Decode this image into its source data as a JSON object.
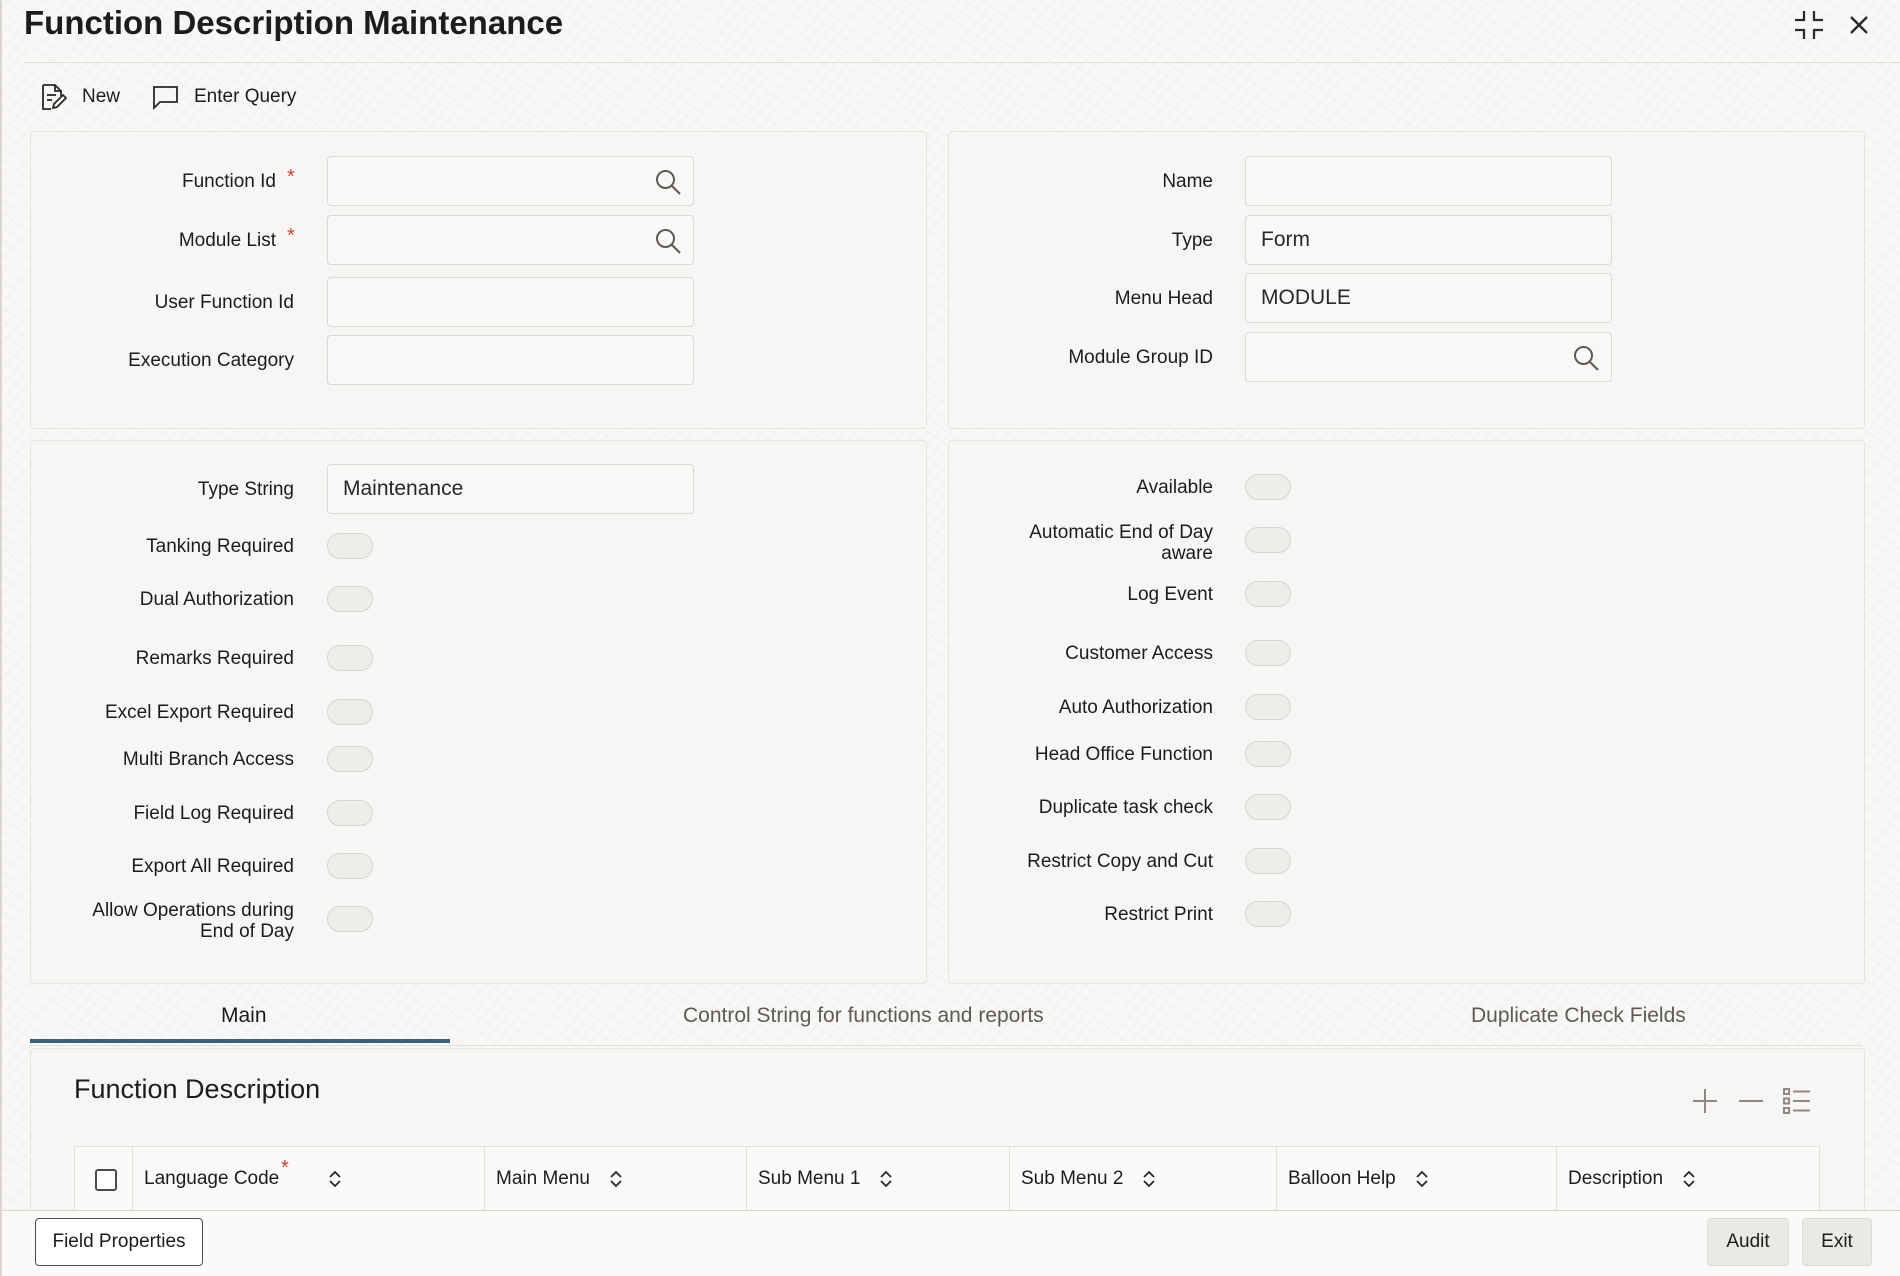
{
  "window": {
    "title": "Function Description Maintenance",
    "restore_label": "restore-window",
    "close_label": "close-window"
  },
  "toolbar": {
    "new_label": "New",
    "enter_query_label": "Enter Query"
  },
  "form": {
    "function_id": {
      "label": "Function Id",
      "value": "",
      "required": "*"
    },
    "module_list": {
      "label": "Module List",
      "value": "",
      "required": "*"
    },
    "user_function_id": {
      "label": "User Function Id",
      "value": ""
    },
    "execution_category": {
      "label": "Execution Category",
      "value": ""
    },
    "name": {
      "label": "Name",
      "value": ""
    },
    "type": {
      "label": "Type",
      "value": "Form"
    },
    "menu_head": {
      "label": "Menu Head",
      "value": "MODULE"
    },
    "module_group_id": {
      "label": "Module Group ID",
      "value": ""
    },
    "type_string": {
      "label": "Type String",
      "value": "Maintenance"
    }
  },
  "left_toggles": [
    {
      "label": "Tanking Required",
      "on": false
    },
    {
      "label": "Dual Authorization",
      "on": false
    },
    {
      "label": "Remarks Required",
      "on": false
    },
    {
      "label": "Excel Export Required",
      "on": false
    },
    {
      "label": "Multi Branch Access",
      "on": false
    },
    {
      "label": "Field Log Required",
      "on": false
    },
    {
      "label": "Export All Required",
      "on": false
    },
    {
      "label_line1": "Allow Operations during",
      "label_line2": "End of Day",
      "on": false
    }
  ],
  "right_toggles": [
    {
      "label": "Available",
      "on": false
    },
    {
      "label_line1": "Automatic End of Day",
      "label_line2": "aware",
      "on": false
    },
    {
      "label": "Log Event",
      "on": false
    },
    {
      "label": "Customer Access",
      "on": false
    },
    {
      "label": "Auto Authorization",
      "on": false
    },
    {
      "label": "Head Office Function",
      "on": false
    },
    {
      "label": "Duplicate task check",
      "on": false
    },
    {
      "label": "Restrict Copy and Cut",
      "on": false
    },
    {
      "label": "Restrict Print",
      "on": false
    }
  ],
  "tabs": [
    {
      "label": "Main",
      "active": true
    },
    {
      "label": "Control String for functions and reports",
      "active": false
    },
    {
      "label": "Duplicate Check Fields",
      "active": false
    }
  ],
  "function_description": {
    "title": "Function Description",
    "columns": [
      "Language Code",
      "Main Menu",
      "Sub Menu 1",
      "Sub Menu 2",
      "Balloon Help",
      "Description"
    ],
    "language_code_required": "*"
  },
  "footer": {
    "field_properties_label": "Field Properties",
    "audit_label": "Audit",
    "exit_label": "Exit"
  },
  "colors": {
    "accent": "#3d5f78",
    "required": "#c74634"
  }
}
